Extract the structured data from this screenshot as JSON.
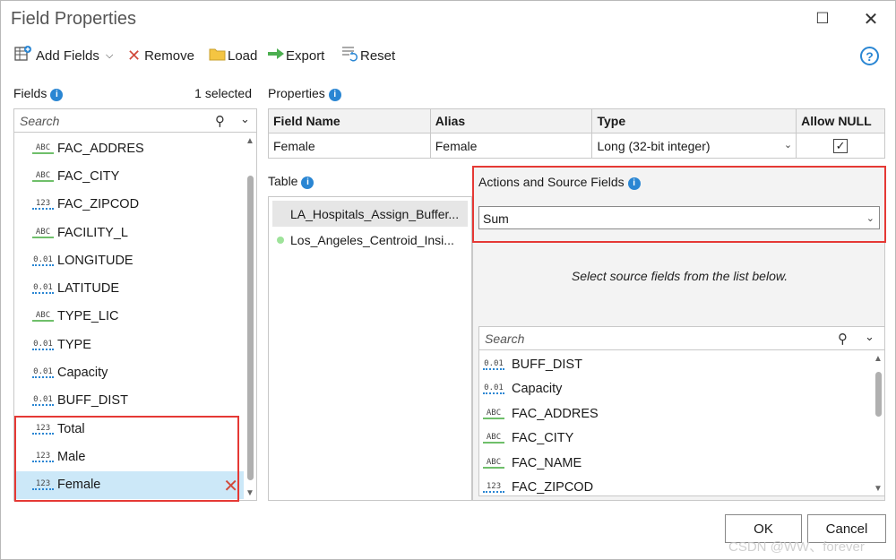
{
  "window": {
    "title": "Field Properties",
    "maximize_glyph": "☐",
    "close_glyph": "✕"
  },
  "toolbar": {
    "add_fields": "Add Fields",
    "remove": "Remove",
    "load": "Load",
    "export": "Export",
    "reset": "Reset",
    "help": "?"
  },
  "fields_panel": {
    "label": "Fields",
    "selected_count": "1 selected",
    "search_placeholder": "Search",
    "items": [
      {
        "type_icon": "ABC",
        "name": "FAC_ADDRES"
      },
      {
        "type_icon": "ABC",
        "name": "FAC_CITY"
      },
      {
        "type_icon": "123",
        "name": "FAC_ZIPCOD"
      },
      {
        "type_icon": "ABC",
        "name": "FACILITY_L"
      },
      {
        "type_icon": "0.01",
        "name": "LONGITUDE"
      },
      {
        "type_icon": "0.01",
        "name": "LATITUDE"
      },
      {
        "type_icon": "ABC",
        "name": "TYPE_LIC"
      },
      {
        "type_icon": "0.01",
        "name": "TYPE"
      },
      {
        "type_icon": "0.01",
        "name": "Capacity"
      },
      {
        "type_icon": "0.01",
        "name": "BUFF_DIST"
      },
      {
        "type_icon": "123",
        "name": "Total"
      },
      {
        "type_icon": "123",
        "name": "Male"
      },
      {
        "type_icon": "123",
        "name": "Female"
      }
    ]
  },
  "properties": {
    "label": "Properties",
    "headers": {
      "name": "Field Name",
      "alias": "Alias",
      "type": "Type",
      "allow_null": "Allow NULL"
    },
    "row": {
      "name": "Female",
      "alias": "Female",
      "type": "Long (32-bit integer)",
      "allow_null": true
    }
  },
  "table_panel": {
    "label": "Table",
    "items": [
      "LA_Hospitals_Assign_Buffer...",
      "Los_Angeles_Centroid_Insi..."
    ]
  },
  "actions_panel": {
    "label": "Actions and Source Fields",
    "action_value": "Sum",
    "hint": "Select source fields from the list below.",
    "search_placeholder": "Search",
    "source_fields": [
      {
        "type_icon": "0.01",
        "name": "BUFF_DIST"
      },
      {
        "type_icon": "0.01",
        "name": "Capacity"
      },
      {
        "type_icon": "ABC",
        "name": "FAC_ADDRES"
      },
      {
        "type_icon": "ABC",
        "name": "FAC_CITY"
      },
      {
        "type_icon": "ABC",
        "name": "FAC_NAME"
      },
      {
        "type_icon": "123",
        "name": "FAC_ZIPCOD"
      }
    ]
  },
  "buttons": {
    "ok": "OK",
    "cancel": "Cancel"
  },
  "watermark": "CSDN @WW、forever",
  "colors": {
    "highlight": "#e53935",
    "selection": "#cce8f8",
    "accent": "#2a86d3"
  }
}
